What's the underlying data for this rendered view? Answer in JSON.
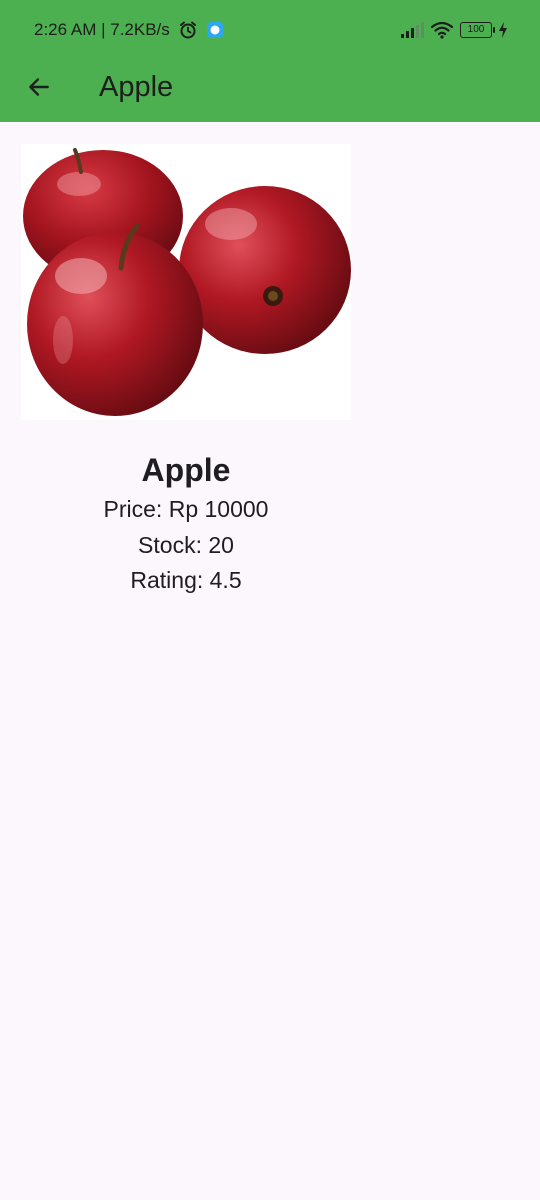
{
  "status_bar": {
    "time_speed": "2:26 AM | 7.2KB/s",
    "battery": "100",
    "background": "#4CAF50"
  },
  "app_bar": {
    "title": "Apple",
    "background": "#4CAF50"
  },
  "product": {
    "name": "Apple",
    "price_text": "Price: Rp 10000",
    "stock_text": "Stock: 20",
    "rating_text": "Rating: 4.5",
    "image_icon": "red-apples-photo"
  },
  "colors": {
    "page_background": "#FCF6FD",
    "text": "#1F1C22"
  }
}
